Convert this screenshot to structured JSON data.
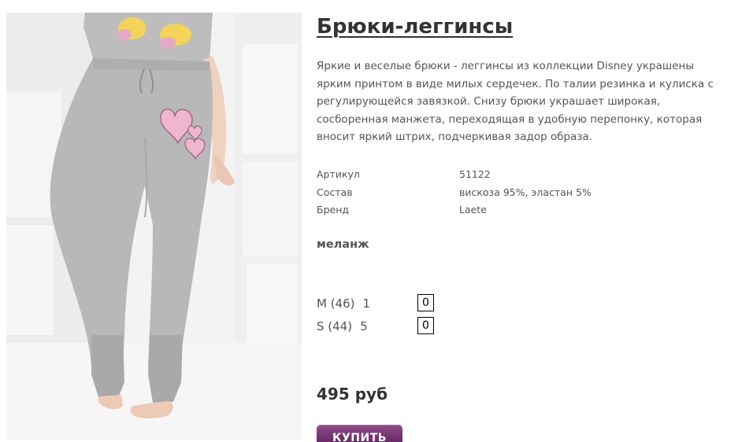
{
  "product": {
    "title": "Брюки-леггинсы",
    "description": "Яркие и веселые брюки - леггинсы из коллекции Disney украшены ярким принтом в виде милых сердечек. По талии резинка и кулиска с регулирующейся завязкой. Снизу брюки украшает широкая, сосборенная манжета, переходящая в удобную перепонку, которая вносит яркий штрих, подчеркивая задор образа.",
    "specs": [
      {
        "label": "Артикул",
        "value": "51122"
      },
      {
        "label": "Состав",
        "value": "вискоза 95%, эластан 5%"
      },
      {
        "label": "Бренд",
        "value": "Laete"
      }
    ],
    "color": "меланж",
    "sizes": [
      {
        "label": "M (46)",
        "stock": "1",
        "quantity": "0"
      },
      {
        "label": "S (44)",
        "stock": "5",
        "quantity": "0"
      }
    ],
    "price": "495 руб",
    "buy_label": "КУПИТЬ"
  },
  "colors": {
    "accent": "#6e2f6c",
    "title": "#333333",
    "text": "#555555",
    "heart": "#f0b6cf"
  }
}
